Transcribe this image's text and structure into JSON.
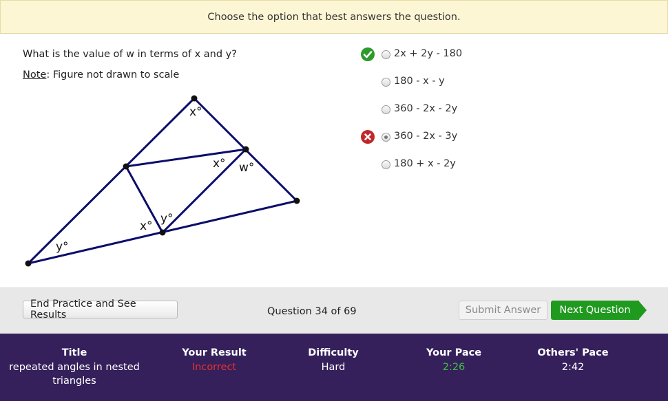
{
  "banner": {
    "text": "Choose the option that best answers the question."
  },
  "question": {
    "text": "What is the value of w in terms of x and y?",
    "note_label": "Note",
    "note_text": ": Figure not drawn to scale"
  },
  "figure": {
    "labels": [
      "x°",
      "x°",
      "w°",
      "x°",
      "y°",
      "y°"
    ]
  },
  "options": [
    {
      "label": "2x + 2y - 180",
      "status": "correct",
      "selected": false
    },
    {
      "label": "180 - x - y",
      "status": "",
      "selected": false
    },
    {
      "label": "360 - 2x - 2y",
      "status": "",
      "selected": false
    },
    {
      "label": "360 - 2x - 3y",
      "status": "incorrect",
      "selected": true
    },
    {
      "label": "180 + x - 2y",
      "status": "",
      "selected": false
    }
  ],
  "toolbar": {
    "end_label": "End Practice and See Results",
    "counter": "Question 34 of 69",
    "submit_label": "Submit Answer",
    "next_label": "Next Question"
  },
  "footer": {
    "title_header": "Title",
    "title_value": "repeated angles in nested triangles",
    "result_header": "Your Result",
    "result_value": "Incorrect",
    "difficulty_header": "Difficulty",
    "difficulty_value": "Hard",
    "pace_header": "Your Pace",
    "pace_value": "2:26",
    "others_header": "Others' Pace",
    "others_value": "2:42"
  },
  "colors": {
    "banner_bg": "#fcf6d4",
    "correct": "#2c9a2c",
    "incorrect": "#c0262a",
    "next_button": "#1f9a1f",
    "footer_bg": "#35205c",
    "figure_lines": "#0d0d6b"
  }
}
